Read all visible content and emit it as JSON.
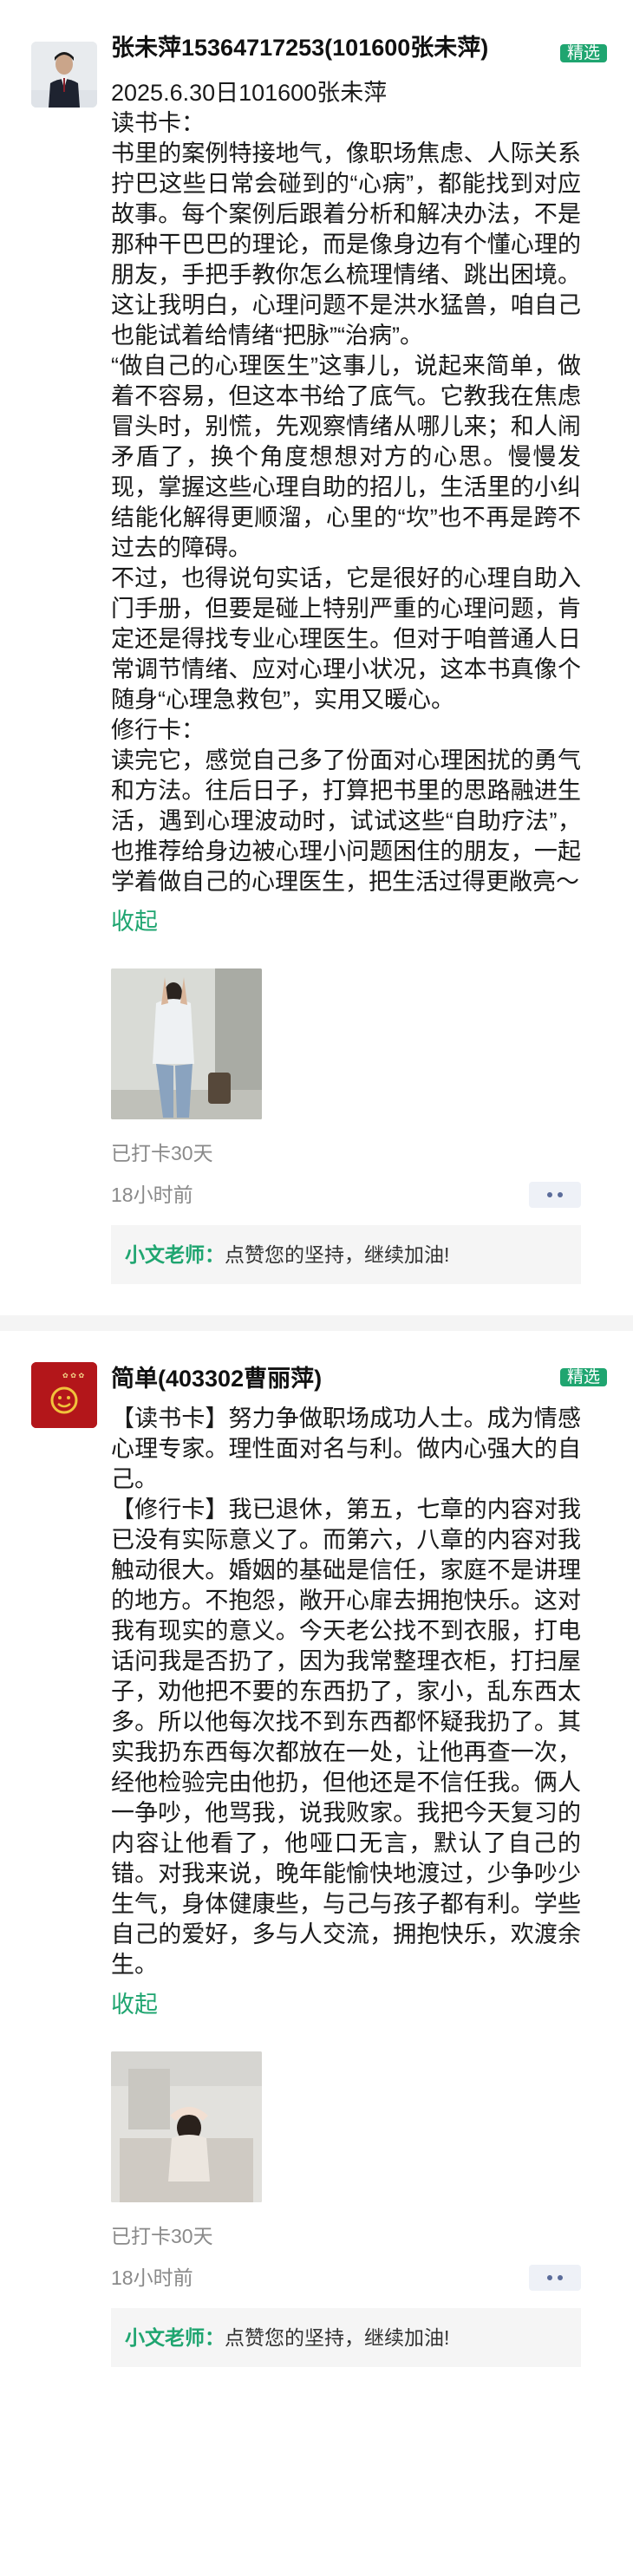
{
  "posts": [
    {
      "name": "张未萍15364717253(101600张未萍)",
      "badge": "精选",
      "text": "2025.6.30日101600张未萍\n读书卡：\n书里的案例特接地气，像职场焦虑、人际关系拧巴这些日常会碰到的“心病”，都能找到对应故事。每个案例后跟着分析和解决办法，不是那种干巴巴的理论，而是像身边有个懂心理的朋友，手把手教你怎么梳理情绪、跳出困境。这让我明白，心理问题不是洪水猛兽，咱自己也能试着给情绪“把脉”“治病”。\n“做自己的心理医生”这事儿，说起来简单，做着不容易，但这本书给了底气。它教我在焦虑冒头时，别慌，先观察情绪从哪儿来；和人闹矛盾了，换个角度想想对方的心思。慢慢发现，掌握这些心理自助的招儿，生活里的小纠结能化解得更顺溜，心里的“坎”也不再是跨不过去的障碍。\n不过，也得说句实话，它是很好的心理自助入门手册，但要是碰上特别严重的心理问题，肯定还是得找专业心理医生。但对于咱普通人日常调节情绪、应对心理小状况，这本书真像个随身“心理急救包”，实用又暖心。\n修行卡：\n读完它，感觉自己多了份面对心理困扰的勇气和方法。往后日子，打算把书里的思路融进生活，遇到心理波动时，试试这些“自助疗法”，也推荐给身边被心理小问题困住的朋友，一起学着做自己的心理医生，把生活过得更敞亮～",
      "collapse": "收起",
      "streak": "已打卡30天",
      "time": "18小时前",
      "comment_author": "小文老师：",
      "comment_text": "点赞您的坚持，继续加油!"
    },
    {
      "name": "简单(403302曹丽萍)",
      "badge": "精选",
      "text": "【读书卡】努力争做职场成功人士。成为情感心理专家。理性面对名与利。做内心强大的自己。\n【修行卡】我已退休，第五，七章的内容对我已没有实际意义了。而第六，八章的内容对我触动很大。婚姻的基础是信任，家庭不是讲理的地方。不抱怨，敞开心扉去拥抱快乐。这对我有现实的意义。今天老公找不到衣服，打电话问我是否扔了，因为我常整理衣柜，打扫屋子，劝他把不要的东西扔了，家小，乱东西太多。所以他每次找不到东西都怀疑我扔了。其实我扔东西每次都放在一处，让他再查一次，经他检验完由他扔，但他还是不信任我。俩人一争吵，他骂我，说我败家。我把今天复习的内容让他看了，他哑口无言，默认了自己的错。对我来说，晚年能愉快地渡过，少争吵少生气，身体健康些，与己与孩子都有利。学些自己的爱好，多与人交流，拥抱快乐，欢渡余生。",
      "collapse": "收起",
      "streak": "已打卡30天",
      "time": "18小时前",
      "comment_author": "小文老师：",
      "comment_text": "点赞您的坚持，继续加油!"
    }
  ],
  "colors": {
    "accent": "#1fa570",
    "meta": "#8a8a8a",
    "more_dots": "#5b6c9a"
  },
  "icons": {
    "more": "more-dots-icon"
  }
}
